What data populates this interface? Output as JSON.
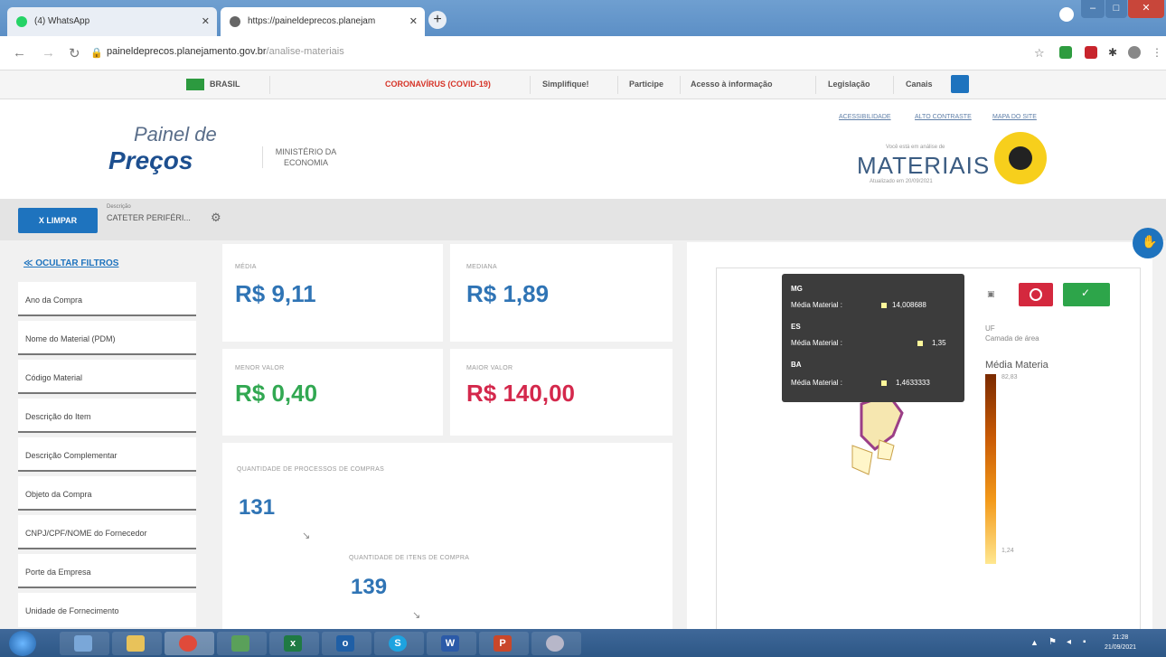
{
  "browser": {
    "tabs": [
      {
        "title": "(4) WhatsApp"
      },
      {
        "title": "https://paineldeprecos.planejam"
      }
    ],
    "url_domain": "paineldeprecos.planejamento.gov.br",
    "url_path": "/analise-materiais"
  },
  "gov_bar": {
    "country": "BRASIL",
    "items": [
      "CORONAVÍRUS (COVID-19)",
      "Simplifique!",
      "Participe",
      "Acesso à informação",
      "Legislação",
      "Canais"
    ]
  },
  "header": {
    "logo_line1": "Painel de",
    "logo_line2": "Preços",
    "ministry_line1": "MINISTÉRIO DA",
    "ministry_line2": "ECONOMIA",
    "links": [
      "ACESSIBILIDADE",
      "ALTO CONTRASTE",
      "MAPA DO SITE"
    ],
    "analysis_label": "Você está em análise de",
    "section": "MATERIAIS",
    "updated": "Atualizado em 20/09/2021"
  },
  "filter": {
    "clear_label": "X LIMPAR",
    "desc_label": "Descrição",
    "desc_value": "CATETER PERIFÉRI..."
  },
  "sidebar": {
    "hide_filters": "≪ OCULTAR FILTROS",
    "items": [
      "Ano da Compra",
      "Nome do Material (PDM)",
      "Código Material",
      "Descrição do Item",
      "Descrição Complementar",
      "Objeto da Compra",
      "CNPJ/CPF/NOME do Fornecedor",
      "Porte da Empresa",
      "Unidade de Fornecimento"
    ]
  },
  "stats": {
    "media_label": "MÉDIA",
    "media_value": "R$ 9,11",
    "mediana_label": "MEDIANA",
    "mediana_value": "R$ 1,89",
    "menor_label": "MENOR VALOR",
    "menor_value": "R$ 0,40",
    "maior_label": "MAIOR VALOR",
    "maior_value": "R$ 140,00",
    "qtd_processos_label": "QUANTIDADE DE PROCESSOS DE COMPRAS",
    "qtd_processos_value": "131",
    "qtd_itens_label": "QUANTIDADE DE ITENS DE COMPRA",
    "qtd_itens_value": "139"
  },
  "map": {
    "tooltip": [
      {
        "uf": "MG",
        "label": "Média Material :",
        "value": "14,008688"
      },
      {
        "uf": "ES",
        "label": "Média Material :",
        "value": "1,35"
      },
      {
        "uf": "BA",
        "label": "Média Material :",
        "value": "1,4633333"
      }
    ],
    "legend_uf": "UF",
    "legend_layer": "Camada de área",
    "legend_title": "Média Materia",
    "legend_max": "82,83",
    "legend_min": "1,24"
  },
  "taskbar": {
    "time": "21:28",
    "date": "21/09/2021"
  }
}
